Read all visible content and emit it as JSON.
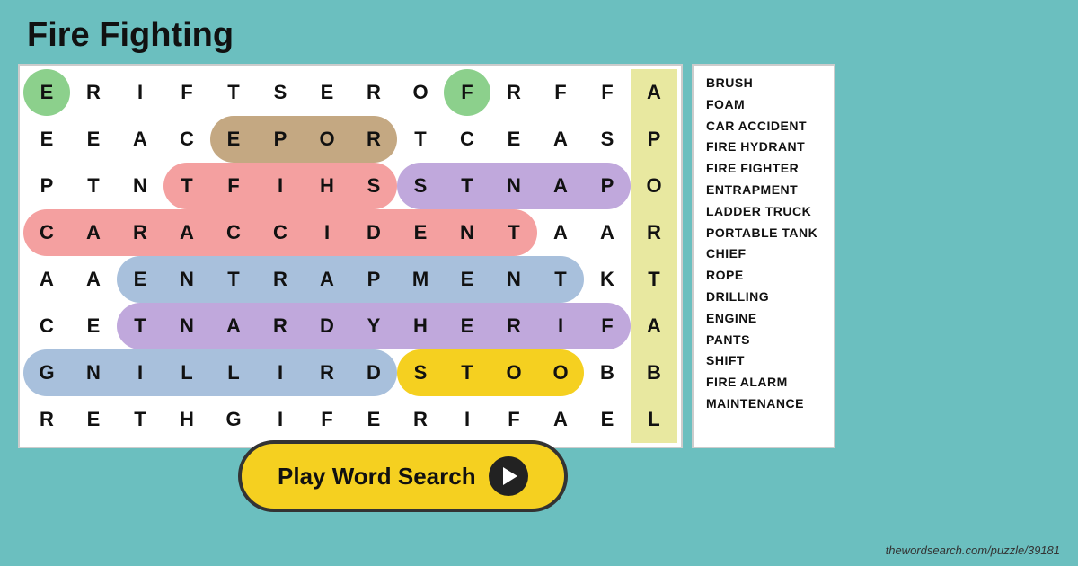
{
  "title": "Fire Fighting",
  "website": "thewordsearch.com/puzzle/39181",
  "play_button": {
    "label": "Play Word Search"
  },
  "word_list": [
    "BRUSH",
    "FOAM",
    "CAR ACCIDENT",
    "FIRE HYDRANT",
    "FIRE FIGHTER",
    "ENTRAPMENT",
    "LADDER TRUCK",
    "PORTABLE TANK",
    "CHIEF",
    "ROPE",
    "DRILLING",
    "ENGINE",
    "PANTS",
    "SHIFT",
    "FIRE ALARM",
    "MAINTENANCE"
  ],
  "grid": [
    [
      "E",
      "R",
      "I",
      "F",
      "T",
      "S",
      "E",
      "R",
      "O",
      "F",
      "R",
      "F",
      "F",
      "A"
    ],
    [
      "E",
      "E",
      "A",
      "C",
      "E",
      "P",
      "O",
      "R",
      "T",
      "C",
      "E",
      "A",
      "S",
      "P"
    ],
    [
      "P",
      "T",
      "N",
      "T",
      "F",
      "I",
      "H",
      "S",
      "S",
      "T",
      "N",
      "A",
      "P",
      "O"
    ],
    [
      "C",
      "A",
      "R",
      "A",
      "C",
      "C",
      "I",
      "D",
      "E",
      "N",
      "T",
      "A",
      "A",
      "R"
    ],
    [
      "A",
      "A",
      "E",
      "N",
      "T",
      "R",
      "A",
      "P",
      "M",
      "E",
      "N",
      "T",
      "K",
      "T"
    ],
    [
      "C",
      "E",
      "T",
      "N",
      "A",
      "R",
      "D",
      "Y",
      "H",
      "E",
      "R",
      "I",
      "F",
      "A"
    ],
    [
      "G",
      "N",
      "I",
      "L",
      "L",
      "I",
      "R",
      "D",
      "S",
      "T",
      "O",
      "O",
      "B",
      "B"
    ],
    [
      "R",
      "E",
      "T",
      "H",
      "G",
      "I",
      "F",
      "E",
      "R",
      "I",
      "F",
      "A",
      "E",
      "L"
    ]
  ]
}
